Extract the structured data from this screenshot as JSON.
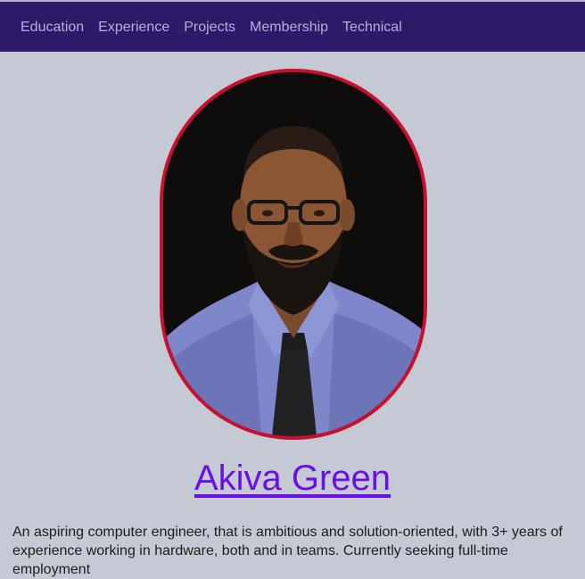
{
  "nav": {
    "items": [
      "Education",
      "Experience",
      "Projects",
      "Membership",
      "Technical"
    ]
  },
  "profile": {
    "photo_alt": "Akiva Green portrait",
    "name": "Akiva Green",
    "bio": "An aspiring computer engineer, that is ambitious and solution-oriented, with 3+ years of experience working in hardware, both and in teams. Currently seeking full-time employment"
  },
  "colors": {
    "nav_bg": "#2d1a68",
    "page_bg": "#c5c9d3",
    "frame_border": "#c8102e",
    "link": "#6a0fe8"
  }
}
